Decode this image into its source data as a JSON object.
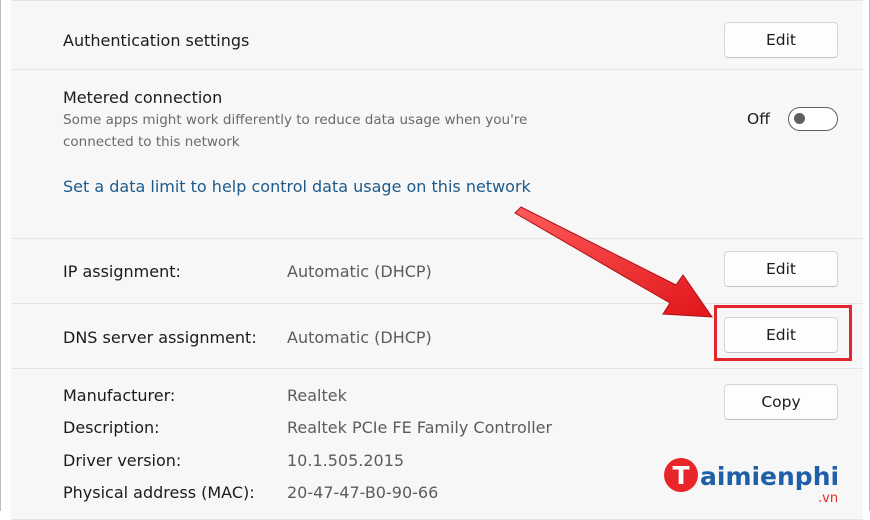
{
  "authentication": {
    "label": "Authentication settings",
    "button": "Edit"
  },
  "metered": {
    "title": "Metered connection",
    "description": "Some apps might work differently to reduce data usage when you're connected to this network",
    "toggle_label": "Off",
    "toggle_on": false,
    "data_limit_link": "Set a data limit to help control data usage on this network"
  },
  "ip_assignment": {
    "label": "IP assignment:",
    "value": "Automatic (DHCP)",
    "button": "Edit"
  },
  "dns_assignment": {
    "label": "DNS server assignment:",
    "value": "Automatic (DHCP)",
    "button": "Edit"
  },
  "properties": {
    "copy_button": "Copy",
    "rows": [
      {
        "label": "Manufacturer:",
        "value": "Realtek"
      },
      {
        "label": "Description:",
        "value": "Realtek PCIe FE Family Controller"
      },
      {
        "label": "Driver version:",
        "value": "10.1.505.2015"
      },
      {
        "label": "Physical address (MAC):",
        "value": "20-47-47-B0-90-66"
      }
    ]
  },
  "watermark": {
    "brand": "aimienphi",
    "initial": "T",
    "tld": ".vn"
  },
  "colors": {
    "accent_link": "#1d5a8c",
    "annotation_red": "#e3262b",
    "watermark_blue": "#1f5fa8",
    "watermark_red": "#e8262a"
  },
  "icons": {
    "annotation_arrow": "arrow-icon",
    "toggle_switch": "toggle-icon"
  }
}
